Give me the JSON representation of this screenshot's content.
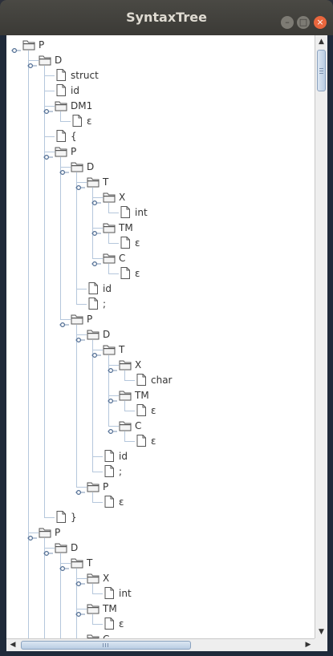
{
  "window": {
    "title": "SyntaxTree"
  },
  "controls": {
    "minimize": "–",
    "maximize": "□",
    "close": "×"
  },
  "scrollbar": {
    "up": "▲",
    "down": "▼",
    "left": "◀",
    "right": "▶"
  },
  "tree": [
    {
      "label": "P",
      "depth": 0,
      "type": "folder",
      "row": 0
    },
    {
      "label": "D",
      "depth": 1,
      "type": "folder",
      "row": 1
    },
    {
      "label": "struct",
      "depth": 2,
      "type": "leaf",
      "row": 2
    },
    {
      "label": "id",
      "depth": 2,
      "type": "leaf",
      "row": 3
    },
    {
      "label": "DM1",
      "depth": 2,
      "type": "folder",
      "row": 4
    },
    {
      "label": "ε",
      "depth": 3,
      "type": "leaf",
      "row": 5
    },
    {
      "label": "{",
      "depth": 2,
      "type": "leaf",
      "row": 6
    },
    {
      "label": "P",
      "depth": 2,
      "type": "folder",
      "row": 7
    },
    {
      "label": "D",
      "depth": 3,
      "type": "folder",
      "row": 8
    },
    {
      "label": "T",
      "depth": 4,
      "type": "folder",
      "row": 9
    },
    {
      "label": "X",
      "depth": 5,
      "type": "folder",
      "row": 10
    },
    {
      "label": "int",
      "depth": 6,
      "type": "leaf",
      "row": 11
    },
    {
      "label": "TM",
      "depth": 5,
      "type": "folder",
      "row": 12
    },
    {
      "label": "ε",
      "depth": 6,
      "type": "leaf",
      "row": 13
    },
    {
      "label": "C",
      "depth": 5,
      "type": "folder",
      "row": 14
    },
    {
      "label": "ε",
      "depth": 6,
      "type": "leaf",
      "row": 15
    },
    {
      "label": "id",
      "depth": 4,
      "type": "leaf",
      "row": 16
    },
    {
      "label": ";",
      "depth": 4,
      "type": "leaf",
      "row": 17
    },
    {
      "label": "P",
      "depth": 3,
      "type": "folder",
      "row": 18
    },
    {
      "label": "D",
      "depth": 4,
      "type": "folder",
      "row": 19
    },
    {
      "label": "T",
      "depth": 5,
      "type": "folder",
      "row": 20
    },
    {
      "label": "X",
      "depth": 6,
      "type": "folder",
      "row": 21
    },
    {
      "label": "char",
      "depth": 7,
      "type": "leaf",
      "row": 22
    },
    {
      "label": "TM",
      "depth": 6,
      "type": "folder",
      "row": 23
    },
    {
      "label": "ε",
      "depth": 7,
      "type": "leaf",
      "row": 24
    },
    {
      "label": "C",
      "depth": 6,
      "type": "folder",
      "row": 25
    },
    {
      "label": "ε",
      "depth": 7,
      "type": "leaf",
      "row": 26
    },
    {
      "label": "id",
      "depth": 5,
      "type": "leaf",
      "row": 27
    },
    {
      "label": ";",
      "depth": 5,
      "type": "leaf",
      "row": 28
    },
    {
      "label": "P",
      "depth": 4,
      "type": "folder",
      "row": 29
    },
    {
      "label": "ε",
      "depth": 5,
      "type": "leaf",
      "row": 30
    },
    {
      "label": "}",
      "depth": 2,
      "type": "leaf",
      "row": 31
    },
    {
      "label": "P",
      "depth": 1,
      "type": "folder",
      "row": 32
    },
    {
      "label": "D",
      "depth": 2,
      "type": "folder",
      "row": 33
    },
    {
      "label": "T",
      "depth": 3,
      "type": "folder",
      "row": 34
    },
    {
      "label": "X",
      "depth": 4,
      "type": "folder",
      "row": 35
    },
    {
      "label": "int",
      "depth": 5,
      "type": "leaf",
      "row": 36
    },
    {
      "label": "TM",
      "depth": 4,
      "type": "folder",
      "row": 37
    },
    {
      "label": "ε",
      "depth": 5,
      "type": "leaf",
      "row": 38
    },
    {
      "label": "C",
      "depth": 4,
      "type": "folder",
      "row": 39
    }
  ]
}
